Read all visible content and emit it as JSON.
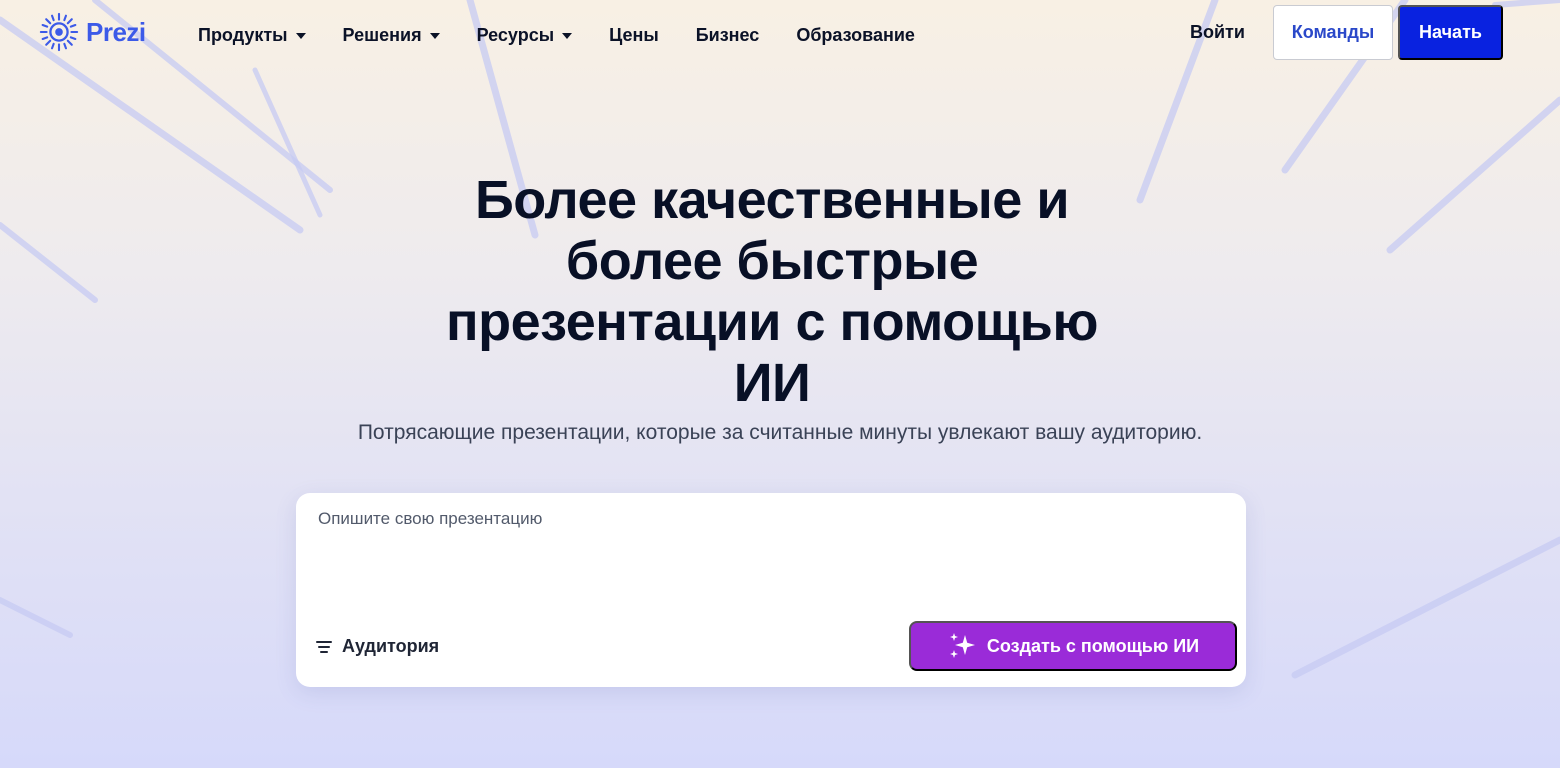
{
  "brand": {
    "name": "Prezi",
    "color": "#3c5ae8"
  },
  "nav": {
    "items": [
      {
        "label": "Продукты",
        "has_dropdown": true
      },
      {
        "label": "Решения",
        "has_dropdown": true
      },
      {
        "label": "Ресурсы",
        "has_dropdown": true
      },
      {
        "label": "Цены",
        "has_dropdown": false
      },
      {
        "label": "Бизнес",
        "has_dropdown": false
      },
      {
        "label": "Образование",
        "has_dropdown": false
      }
    ],
    "login_label": "Войти",
    "teams_label": "Команды",
    "start_label": "Начать"
  },
  "hero": {
    "title": "Более качественные и более быстрые презентации с помощью ИИ",
    "subtitle": "Потрясающие презентации, которые за считанные минуты увлекают вашу аудиторию."
  },
  "prompt_card": {
    "placeholder": "Опишите свою презентацию",
    "value": "",
    "audience_label": "Аудитория",
    "create_button_label": "Создать с помощью ИИ",
    "create_button_color": "#9a2bd8"
  },
  "colors": {
    "primary_button": "#0922e0",
    "heading": "#081026"
  }
}
